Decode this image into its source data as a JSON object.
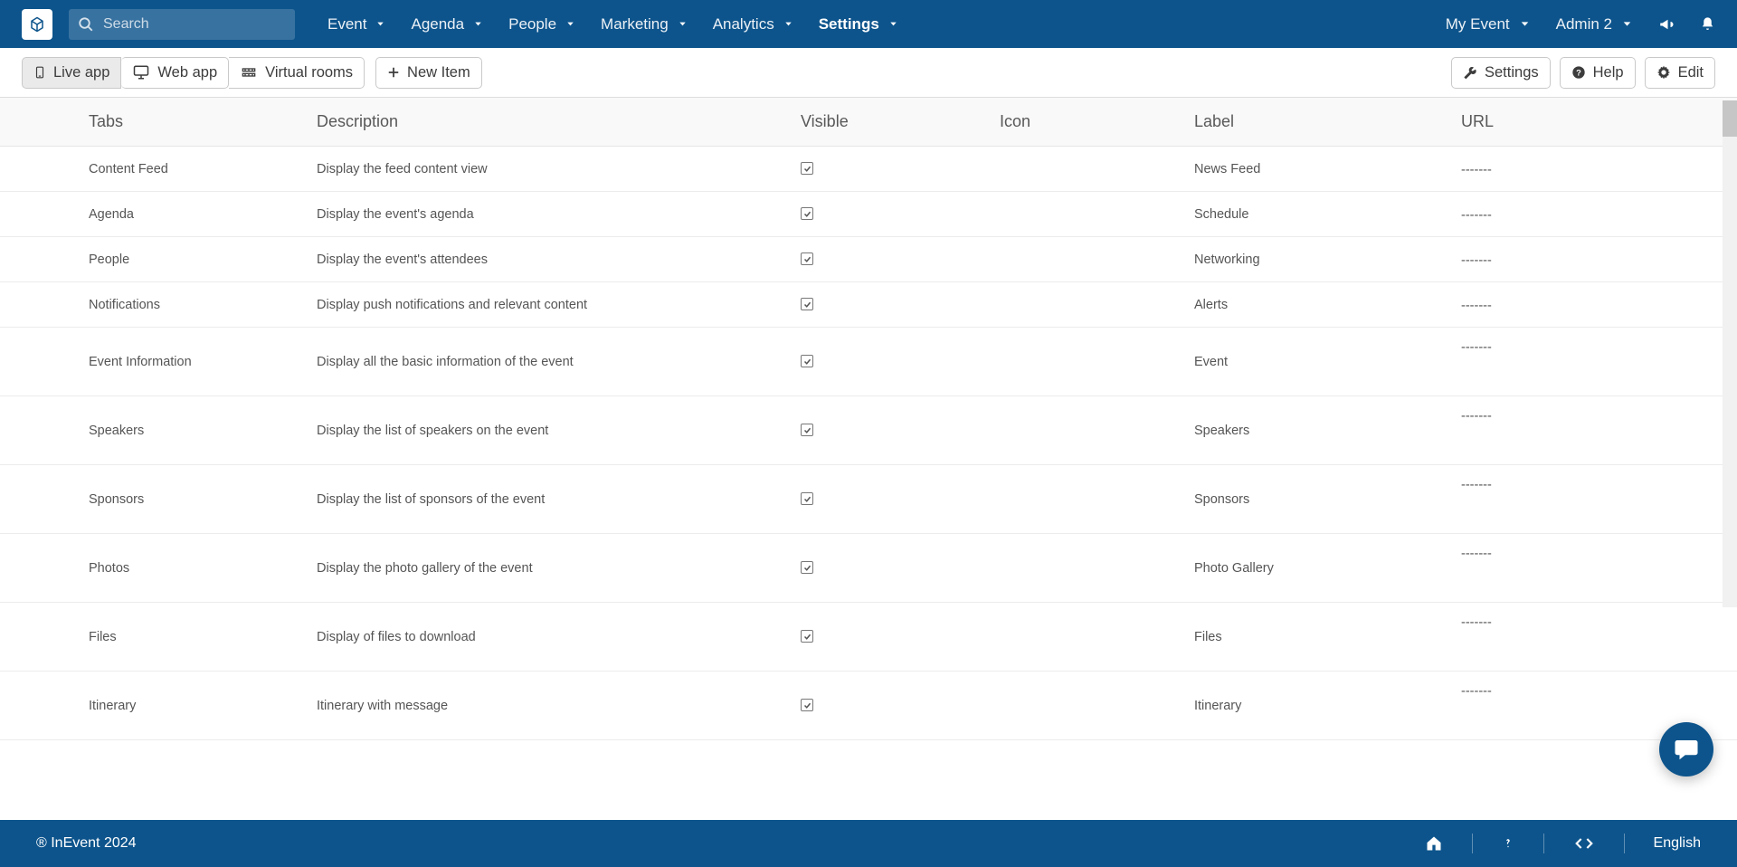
{
  "navbar": {
    "search_placeholder": "Search",
    "items": [
      {
        "label": "Event"
      },
      {
        "label": "Agenda"
      },
      {
        "label": "People"
      },
      {
        "label": "Marketing"
      },
      {
        "label": "Analytics"
      },
      {
        "label": "Settings"
      }
    ],
    "event_switcher": "My Event",
    "user": "Admin 2"
  },
  "toolbar": {
    "view_tabs": [
      {
        "label": "Live app"
      },
      {
        "label": "Web app"
      },
      {
        "label": "Virtual rooms"
      }
    ],
    "new_item": "New Item",
    "settings": "Settings",
    "help": "Help",
    "edit": "Edit"
  },
  "table": {
    "headers": {
      "tabs": "Tabs",
      "description": "Description",
      "visible": "Visible",
      "icon": "Icon",
      "label": "Label",
      "url": "URL"
    },
    "rows": [
      {
        "tab": "Content Feed",
        "description": "Display the feed content view",
        "visible": true,
        "label": "News Feed",
        "url": "-------",
        "tall": false
      },
      {
        "tab": "Agenda",
        "description": "Display the event's agenda",
        "visible": true,
        "label": "Schedule",
        "url": "-------",
        "tall": false
      },
      {
        "tab": "People",
        "description": "Display the event's attendees",
        "visible": true,
        "label": "Networking",
        "url": "-------",
        "tall": false
      },
      {
        "tab": "Notifications",
        "description": "Display push notifications and relevant content",
        "visible": true,
        "label": "Alerts",
        "url": "-------",
        "tall": false
      },
      {
        "tab": "Event Information",
        "description": "Display all the basic information of the event",
        "visible": true,
        "label": "Event",
        "url": "-------",
        "tall": true
      },
      {
        "tab": "Speakers",
        "description": "Display the list of speakers on the event",
        "visible": true,
        "label": "Speakers",
        "url": "-------",
        "tall": true
      },
      {
        "tab": "Sponsors",
        "description": "Display the list of sponsors of the event",
        "visible": true,
        "label": "Sponsors",
        "url": "-------",
        "tall": true
      },
      {
        "tab": "Photos",
        "description": "Display the photo gallery of the event",
        "visible": true,
        "label": "Photo Gallery",
        "url": "-------",
        "tall": true
      },
      {
        "tab": "Files",
        "description": "Display of files to download",
        "visible": true,
        "label": "Files",
        "url": "-------",
        "tall": true
      },
      {
        "tab": "Itinerary",
        "description": "Itinerary with message",
        "visible": true,
        "label": "Itinerary",
        "url": "-------",
        "tall": true
      }
    ]
  },
  "footer": {
    "copyright": "® InEvent 2024",
    "language": "English"
  }
}
